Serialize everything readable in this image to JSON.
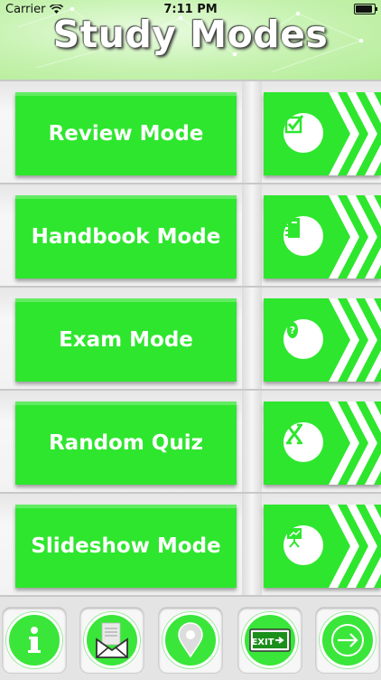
{
  "status_bar": {
    "carrier": "Carrier",
    "time": "7:11 PM"
  },
  "header": {
    "title": "Study Modes"
  },
  "modes": [
    {
      "label": "Review Mode",
      "icon": "checkbox-icon"
    },
    {
      "label": "Handbook Mode",
      "icon": "notebook-icon"
    },
    {
      "label": "Exam Mode",
      "icon": "question-icon"
    },
    {
      "label": "Random Quiz",
      "icon": "shuffle-icon"
    },
    {
      "label": "Slideshow Mode",
      "icon": "presentation-icon"
    }
  ],
  "toolbar": {
    "buttons": [
      {
        "name": "info",
        "icon": "info-icon"
      },
      {
        "name": "mail",
        "icon": "mail-icon"
      },
      {
        "name": "location",
        "icon": "location-pin-icon"
      },
      {
        "name": "exit",
        "icon": "exit-sign-icon",
        "label": "EXIT"
      },
      {
        "name": "next",
        "icon": "arrow-right-icon"
      }
    ]
  },
  "colors": {
    "accent_green": "#2ee62e",
    "header_green": "#b4ec97",
    "background": "#f0f0f0"
  }
}
